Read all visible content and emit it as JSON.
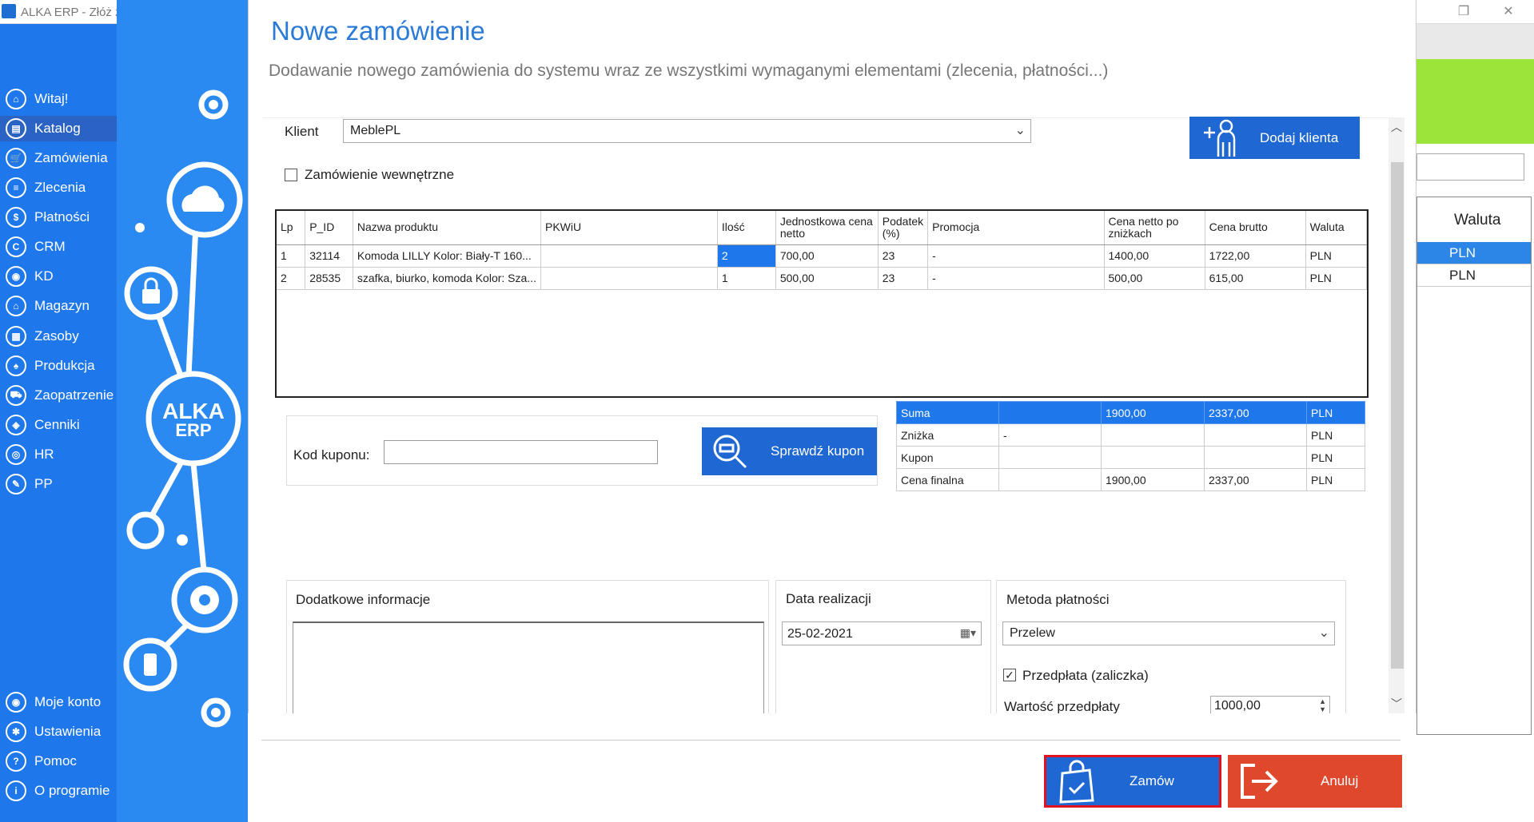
{
  "window": {
    "title": "ALKA ERP - Złóż z"
  },
  "sidebar": {
    "items": [
      {
        "label": "Witaj!",
        "icon": "home-icon",
        "glyph": "⌂"
      },
      {
        "label": "Katalog",
        "icon": "catalog-icon",
        "glyph": "▤"
      },
      {
        "label": "Zamówienia",
        "icon": "cart-icon",
        "glyph": "🛒"
      },
      {
        "label": "Zlecenia",
        "icon": "list-icon",
        "glyph": "≡"
      },
      {
        "label": "Płatności",
        "icon": "dollar-icon",
        "glyph": "$"
      },
      {
        "label": "CRM",
        "icon": "crm-icon",
        "glyph": "C"
      },
      {
        "label": "KD",
        "icon": "person-icon",
        "glyph": "◉"
      },
      {
        "label": "Magazyn",
        "icon": "warehouse-icon",
        "glyph": "⌂"
      },
      {
        "label": "Zasoby",
        "icon": "resources-icon",
        "glyph": "▦"
      },
      {
        "label": "Produkcja",
        "icon": "production-icon",
        "glyph": "♠"
      },
      {
        "label": "Zaopatrzenie",
        "icon": "supply-icon",
        "glyph": "⛟"
      },
      {
        "label": "Cenniki",
        "icon": "tag-icon",
        "glyph": "◈"
      },
      {
        "label": "HR",
        "icon": "hr-icon",
        "glyph": "◎"
      },
      {
        "label": "PP",
        "icon": "pp-icon",
        "glyph": "✎"
      }
    ],
    "bottom_items": [
      {
        "label": "Moje konto",
        "icon": "account-icon",
        "glyph": "◉"
      },
      {
        "label": "Ustawienia",
        "icon": "settings-icon",
        "glyph": "✱"
      },
      {
        "label": "Pomoc",
        "icon": "help-icon",
        "glyph": "?"
      },
      {
        "label": "O programie",
        "icon": "info-icon",
        "glyph": "i"
      }
    ]
  },
  "brand": {
    "logo_text_1": "ALKA",
    "logo_text_2": "ERP"
  },
  "background_table": {
    "header": "Waluta",
    "rows": [
      "PLN",
      "PLN"
    ]
  },
  "dialog": {
    "title": "Nowe zamówienie",
    "subtitle": "Dodawanie nowego zamówienia do systemu wraz ze wszystkimi wymaganymi elementami (zlecenia, płatności...)",
    "client_label": "Klient",
    "client_value": "MeblePL",
    "add_client_label": "Dodaj klienta",
    "internal_order_label": "Zamówienie wewnętrzne",
    "columns": [
      "Lp",
      "P_ID",
      "Nazwa produktu",
      "PKWiU",
      "Ilość",
      "Jednostkowa cena netto",
      "Podatek (%)",
      "Promocja",
      "Cena netto po zniżkach",
      "Cena brutto",
      "Waluta"
    ],
    "rows": [
      [
        "1",
        "32114",
        "Komoda LILLY Kolor: Biały-T 160...",
        "",
        "2",
        "700,00",
        "23",
        "-",
        "1400,00",
        "1722,00",
        "PLN"
      ],
      [
        "2",
        "28535",
        "szafka, biurko, komoda Kolor: Sza...",
        "",
        "1",
        "500,00",
        "23",
        "-",
        "500,00",
        "615,00",
        "PLN"
      ]
    ],
    "summary": [
      [
        "Suma",
        "",
        "1900,00",
        "2337,00",
        "PLN"
      ],
      [
        "Zniżka",
        "-",
        "",
        "",
        "PLN"
      ],
      [
        "Kupon",
        "",
        "",
        "",
        "PLN"
      ],
      [
        "Cena finalna",
        "",
        "1900,00",
        "2337,00",
        "PLN"
      ]
    ],
    "coupon_label": "Kod kuponu:",
    "coupon_value": "",
    "check_coupon_label": "Sprawdź kupon",
    "extra_info_label": "Dodatkowe informacje",
    "extra_info_value": "",
    "date_label": "Data realizacji",
    "date_value": "25-02-2021",
    "payment_label": "Metoda płatności",
    "payment_value": "Przelew",
    "prepayment_label": "Przedpłata (zaliczka)",
    "prepayment_checked": true,
    "prepayment_value_label": "Wartość przedpłaty",
    "prepayment_value": "1000,00",
    "order_button": "Zamów",
    "cancel_button": "Anuluj"
  },
  "colors": {
    "sidebar": "#1f77ec",
    "brand_panel": "#2b8af2",
    "accent": "#1f67d2",
    "cancel": "#e0482e",
    "highlight_border": "#e0121f",
    "title": "#2b7ad6"
  }
}
